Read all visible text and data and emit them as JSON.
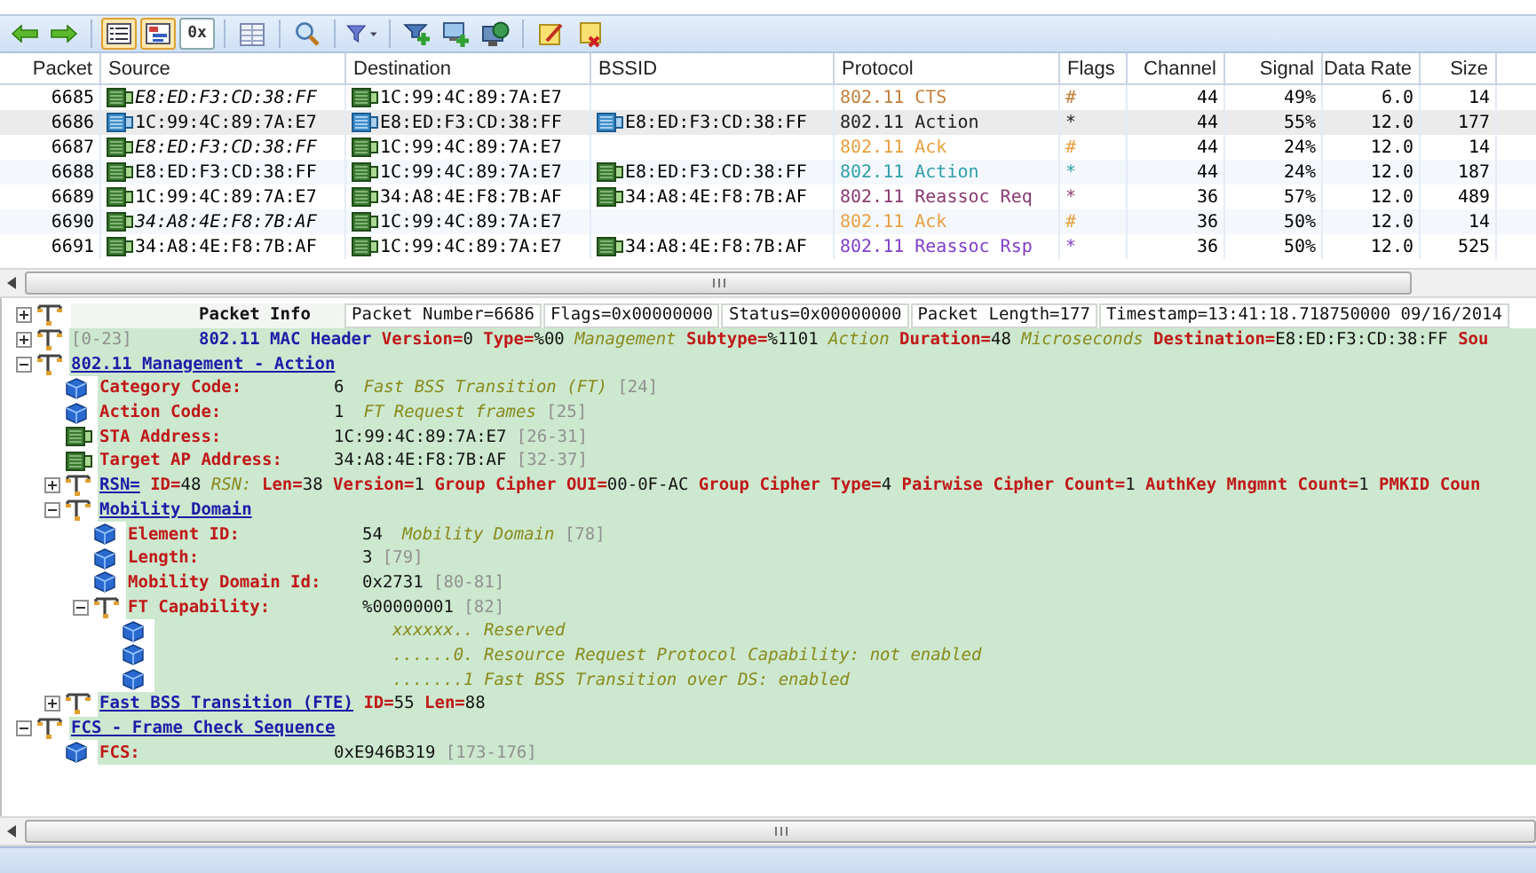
{
  "toolbar": [
    {
      "kind": "back",
      "pressed": false
    },
    {
      "kind": "forward",
      "pressed": false
    },
    {
      "kind": "sep"
    },
    {
      "kind": "list",
      "pressed": true
    },
    {
      "kind": "decode",
      "pressed": true
    },
    {
      "kind": "hex",
      "label": "0x",
      "pressed": false
    },
    {
      "kind": "sep"
    },
    {
      "kind": "grid",
      "pressed": false
    },
    {
      "kind": "sep"
    },
    {
      "kind": "search",
      "pressed": false
    },
    {
      "kind": "sep"
    },
    {
      "kind": "filter",
      "pressed": false
    },
    {
      "kind": "sep"
    },
    {
      "kind": "net-add",
      "pressed": false
    },
    {
      "kind": "net-plus",
      "pressed": false
    },
    {
      "kind": "globe",
      "pressed": false
    },
    {
      "kind": "sep"
    },
    {
      "kind": "note-edit",
      "pressed": false
    },
    {
      "kind": "note-delete",
      "pressed": false
    }
  ],
  "packet_list": {
    "columns": [
      "Packet",
      "Source",
      "Destination",
      "BSSID",
      "Protocol",
      "Flags",
      "Channel",
      "Signal",
      "Data Rate",
      "Size"
    ],
    "rows": [
      {
        "packet": "6685",
        "source": "E8:ED:F3:CD:38:FF",
        "source_italic": true,
        "destination": "1C:99:4C:89:7A:E7",
        "protocol": "802.11 CTS",
        "color": "#c0803a",
        "flags": "#",
        "channel": "44",
        "signal": "49%",
        "data_rate": "6.0",
        "size": "14",
        "selected": false
      },
      {
        "packet": "6686",
        "source": "1C:99:4C:89:7A:E7",
        "source_italic": false,
        "destination": "E8:ED:F3:CD:38:FF",
        "bssid": "E8:ED:F3:CD:38:FF",
        "protocol": "802.11 Action",
        "color": "#202020",
        "flags": "*",
        "channel": "44",
        "signal": "55%",
        "data_rate": "12.0",
        "size": "177",
        "selected": true
      },
      {
        "packet": "6687",
        "source": "E8:ED:F3:CD:38:FF",
        "source_italic": true,
        "destination": "1C:99:4C:89:7A:E7",
        "protocol": "802.11 Ack",
        "color": "#e8a040",
        "flags": "#",
        "channel": "44",
        "signal": "24%",
        "data_rate": "12.0",
        "size": "14",
        "selected": false
      },
      {
        "packet": "6688",
        "source": "E8:ED:F3:CD:38:FF",
        "source_italic": false,
        "destination": "1C:99:4C:89:7A:E7",
        "bssid": "E8:ED:F3:CD:38:FF",
        "protocol": "802.11 Action",
        "color": "#30a0a8",
        "flags": "*",
        "channel": "44",
        "signal": "24%",
        "data_rate": "12.0",
        "size": "187",
        "selected": false
      },
      {
        "packet": "6689",
        "source": "1C:99:4C:89:7A:E7",
        "source_italic": false,
        "destination": "34:A8:4E:F8:7B:AF",
        "bssid": "34:A8:4E:F8:7B:AF",
        "protocol": "802.11 Reassoc Req",
        "color": "#8a3a70",
        "flags": "*",
        "channel": "36",
        "signal": "57%",
        "data_rate": "12.0",
        "size": "489",
        "selected": false
      },
      {
        "packet": "6690",
        "source": "34:A8:4E:F8:7B:AF",
        "source_italic": true,
        "destination": "1C:99:4C:89:7A:E7",
        "protocol": "802.11 Ack",
        "color": "#e8a040",
        "flags": "#",
        "channel": "36",
        "signal": "50%",
        "data_rate": "12.0",
        "size": "14",
        "selected": false
      },
      {
        "packet": "6691",
        "source": "34:A8:4E:F8:7B:AF",
        "source_italic": false,
        "destination": "1C:99:4C:89:7A:E7",
        "bssid": "34:A8:4E:F8:7B:AF",
        "protocol": "802.11 Reassoc Rsp",
        "color": "#8040c8",
        "flags": "*",
        "channel": "36",
        "signal": "50%",
        "data_rate": "12.0",
        "size": "525",
        "selected": false
      }
    ]
  },
  "decode": [
    {
      "kind": "info",
      "expanded": false,
      "label": "Packet Info",
      "cells": [
        "Packet Number=6686",
        "Flags=0x00000000",
        "Status=0x00000000",
        "Packet Length=177",
        "Timestamp=13:41:18.718750000 09/16/2014"
      ]
    },
    {
      "kind": "header",
      "expanded": false,
      "range": "[0-23]",
      "title": "802.11 MAC Header",
      "details": [
        {
          "name": "Version=",
          "value": "0"
        },
        {
          "name": "Type=",
          "value": "%00"
        },
        {
          "desc": "Management"
        },
        {
          "name": "Subtype=",
          "value": "%1101"
        },
        {
          "desc": "Action"
        },
        {
          "name": "Duration=",
          "value": "48"
        },
        {
          "desc": "Microseconds"
        },
        {
          "name": "Destination=",
          "value": "E8:ED:F3:CD:38:FF"
        },
        {
          "name": "Sou"
        }
      ]
    },
    {
      "kind": "section",
      "expanded": true,
      "title": "802.11 Management - Action",
      "children": [
        {
          "kind": "field",
          "name": "Category Code:",
          "value": "6",
          "desc": "Fast BSS Transition (FT)",
          "range": "[24]"
        },
        {
          "kind": "field",
          "name": "Action Code:",
          "value": "1",
          "desc": "FT Request frames",
          "range": "[25]"
        },
        {
          "kind": "address",
          "name": "STA Address:",
          "value": "1C:99:4C:89:7A:E7",
          "range": "[26-31]"
        },
        {
          "kind": "address",
          "name": "Target AP Address:",
          "value": "34:A8:4E:F8:7B:AF",
          "range": "[32-37]"
        },
        {
          "kind": "section",
          "expanded": false,
          "title": "RSN=",
          "details": [
            {
              "name": "ID=",
              "value": "48"
            },
            {
              "desc": "RSN:"
            },
            {
              "name": "Len=",
              "value": "38"
            },
            {
              "name": "Version=",
              "value": "1"
            },
            {
              "name": "Group Cipher OUI=",
              "value": "00-0F-AC"
            },
            {
              "name": "Group Cipher Type=",
              "value": "4"
            },
            {
              "name": "Pairwise Cipher Count=",
              "value": "1"
            },
            {
              "name": "AuthKey Mngmnt Count=",
              "value": "1"
            },
            {
              "name": "PMKID Coun"
            }
          ]
        },
        {
          "kind": "section",
          "expanded": true,
          "title": "Mobility Domain",
          "children": [
            {
              "kind": "field",
              "name": "Element ID:",
              "value": "54",
              "desc": "Mobility Domain",
              "range": "[78]"
            },
            {
              "kind": "field",
              "name": "Length:",
              "value": "3",
              "range": "[79]"
            },
            {
              "kind": "field",
              "name": "Mobility Domain Id:",
              "value": "0x2731",
              "range": "[80-81]"
            },
            {
              "kind": "flags",
              "expanded": true,
              "name": "FT Capability:",
              "value": "%00000001",
              "range": "[82]",
              "children": [
                {
                  "kind": "bit",
                  "text": "xxxxxx.. Reserved"
                },
                {
                  "kind": "bit",
                  "text": "......0. Resource Request Protocol Capability: not enabled"
                },
                {
                  "kind": "bit",
                  "text": ".......1 Fast BSS Transition over DS: enabled"
                }
              ]
            }
          ]
        },
        {
          "kind": "section",
          "expanded": false,
          "title": "Fast BSS Transition (FTE)",
          "details": [
            {
              "name": "ID=",
              "value": "55"
            },
            {
              "name": "Len=",
              "value": "88"
            }
          ]
        }
      ]
    },
    {
      "kind": "section",
      "expanded": true,
      "title": "FCS - Frame Check Sequence",
      "children": [
        {
          "kind": "field",
          "name": "FCS:",
          "value": "0xE946B319",
          "range": "[173-176]"
        }
      ]
    }
  ]
}
